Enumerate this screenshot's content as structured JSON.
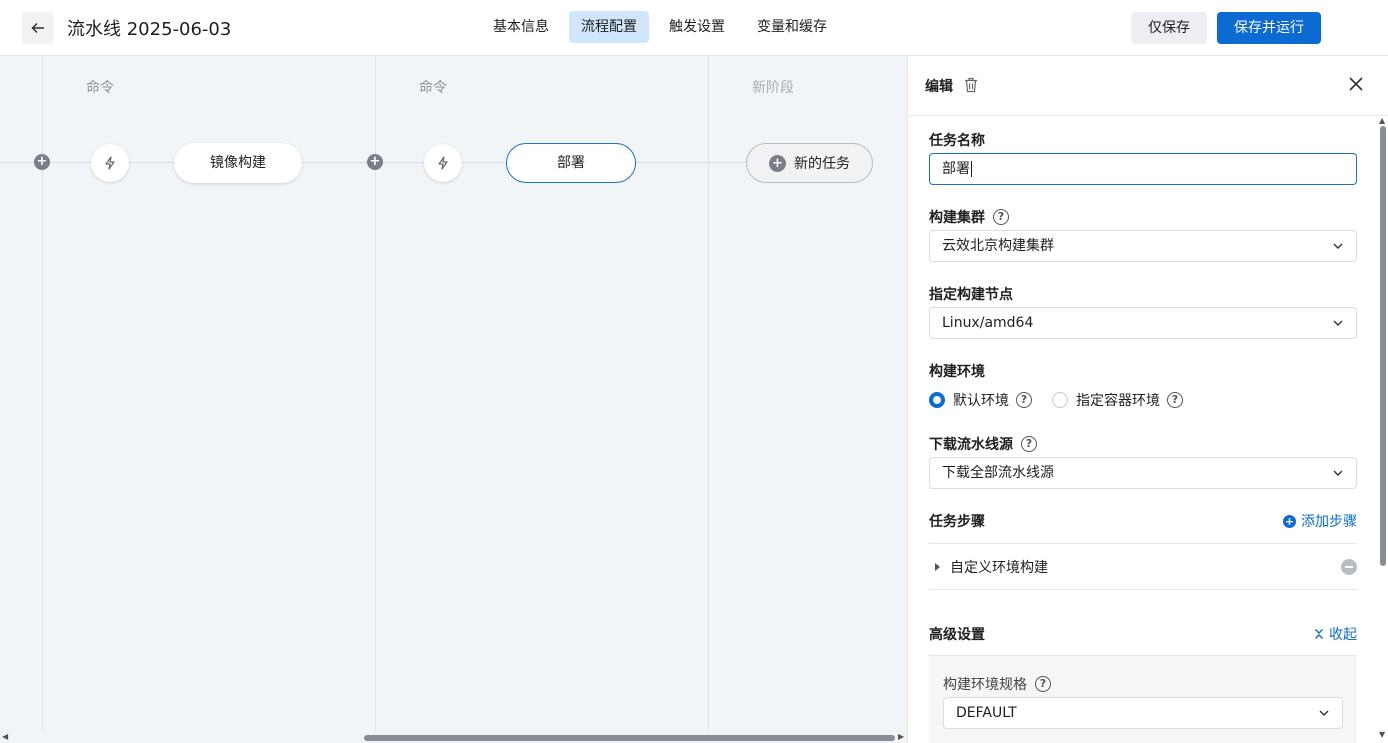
{
  "header": {
    "title": "流水线 2025-06-03",
    "tabs": [
      {
        "label": "基本信息",
        "active": false
      },
      {
        "label": "流程配置",
        "active": true
      },
      {
        "label": "触发设置",
        "active": false
      },
      {
        "label": "变量和缓存",
        "active": false
      }
    ],
    "save_label": "仅保存",
    "save_run_label": "保存并运行"
  },
  "canvas": {
    "stages": [
      {
        "label": "命令",
        "job": "镜像构建",
        "selected": false
      },
      {
        "label": "命令",
        "job": "部署",
        "selected": true
      },
      {
        "label": "新阶段"
      }
    ],
    "new_job_label": "新的任务"
  },
  "panel": {
    "title": "编辑",
    "task_name_label": "任务名称",
    "task_name_value": "部署",
    "cluster_label": "构建集群",
    "cluster_value": "云效北京构建集群",
    "node_label": "指定构建节点",
    "node_value": "Linux/amd64",
    "env_label": "构建环境",
    "env_options": [
      {
        "label": "默认环境",
        "checked": true
      },
      {
        "label": "指定容器环境",
        "checked": false
      }
    ],
    "source_label": "下载流水线源",
    "source_value": "下载全部流水线源",
    "steps_label": "任务步骤",
    "add_step_label": "添加步骤",
    "steps": [
      {
        "label": "自定义环境构建"
      }
    ],
    "advanced_label": "高级设置",
    "collapse_label": "收起",
    "spec_label": "构建环境规格",
    "spec_value": "DEFAULT"
  },
  "colors": {
    "primary": "#0b6bd3",
    "active_tab_bg": "#cfe6fb",
    "canvas_bg": "#f2f5f8"
  }
}
